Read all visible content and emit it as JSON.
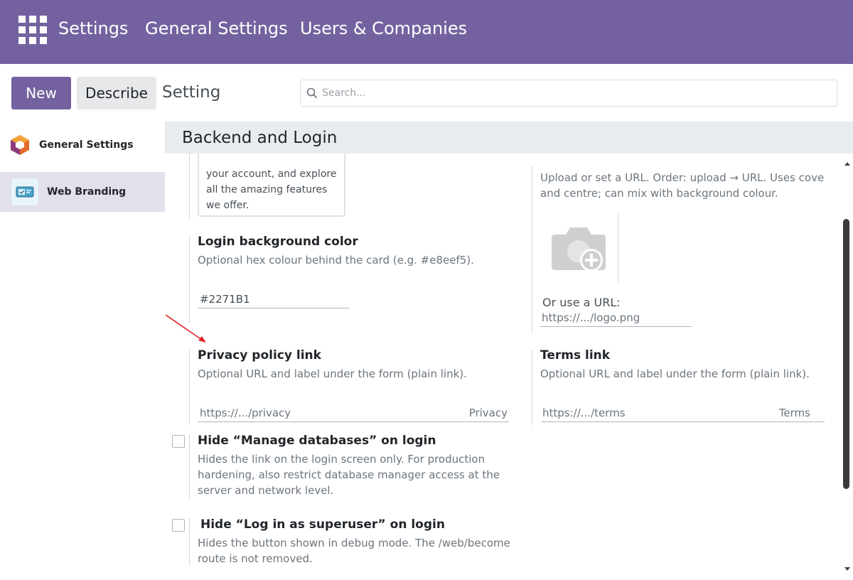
{
  "navbar": {
    "brand": "Settings",
    "menu": [
      "General Settings",
      "Users & Companies"
    ],
    "color": "#7462a0"
  },
  "control": {
    "new_label": "New",
    "describe_label": "Describe",
    "breadcrumb": "Setting",
    "search_placeholder": "Search..."
  },
  "sidebar": {
    "items": [
      {
        "label": "General Settings",
        "icon": "odoo-hexagon-icon"
      },
      {
        "label": "Web Branding",
        "icon": "web-branding-icon",
        "active": true
      }
    ]
  },
  "section": {
    "title": "Backend and Login"
  },
  "fields": {
    "welcome_text_lines": [
      "your account, and explore",
      "all the amazing features",
      "we offer."
    ],
    "background_image_desc_1": "Upload or set a URL. Order: upload → URL. Uses cove",
    "background_image_desc_2": "and centre; can mix with background colour.",
    "bg_color": {
      "label": "Login background color",
      "desc": "Optional hex colour behind the card (e.g. #e8eef5).",
      "value": "#2271B1"
    },
    "or_url": {
      "label": "Or use a URL:",
      "placeholder": "https://.../logo.png"
    },
    "privacy": {
      "label": "Privacy policy link",
      "desc": "Optional URL and label under the form (plain link).",
      "url_placeholder": "https://.../privacy",
      "label_placeholder": "Privacy"
    },
    "terms": {
      "label": "Terms link",
      "desc": "Optional URL and label under the form (plain link).",
      "url_placeholder": "https://.../terms",
      "label_placeholder": "Terms"
    },
    "hide_db": {
      "label": "Hide “Manage databases” on login",
      "desc_lines": [
        "Hides the link on the login screen only. For production",
        "hardening, also restrict database manager access at the",
        "server and network level."
      ],
      "checked": false
    },
    "hide_superuser": {
      "label": "Hide “Log in as superuser” on login",
      "desc_lines": [
        "Hides the button shown in debug mode. The /web/become",
        "route is not removed."
      ],
      "checked": false
    }
  }
}
